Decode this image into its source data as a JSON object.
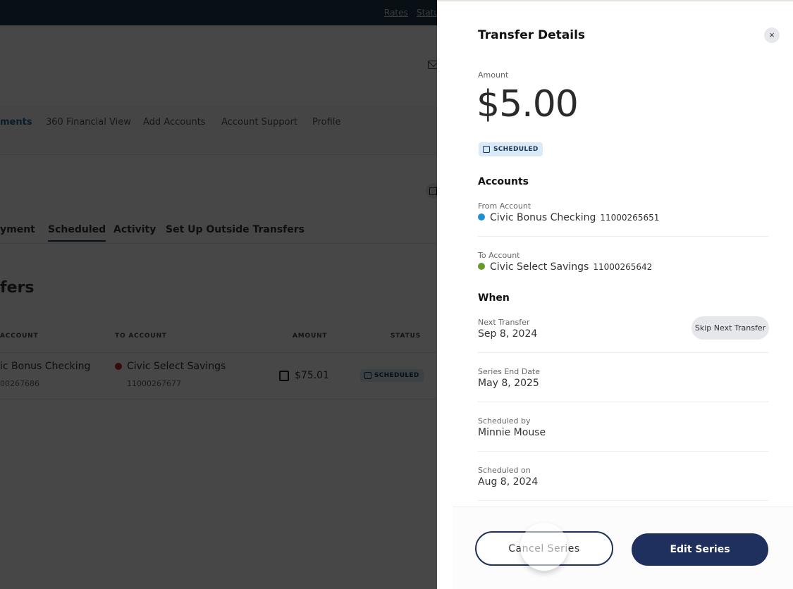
{
  "background": {
    "utility_links": [
      "Rates",
      "Status"
    ],
    "main_nav": [
      {
        "label": "ments",
        "active": true
      },
      {
        "label": "360 Financial View",
        "active": false
      },
      {
        "label": "Add Accounts",
        "active": false
      },
      {
        "label": "Account Support",
        "active": false
      },
      {
        "label": "Profile",
        "active": false
      }
    ],
    "sub_tabs": [
      {
        "label": "yment",
        "active": false
      },
      {
        "label": "Scheduled",
        "active": true
      },
      {
        "label": "Activity",
        "active": false
      },
      {
        "label": "Set Up Outside Transfers",
        "active": false
      }
    ],
    "section_title": "fers",
    "table": {
      "columns": [
        "ACCOUNT",
        "TO ACCOUNT",
        "AMOUNT",
        "STATUS"
      ],
      "rows": [
        {
          "from_name": "ic Bonus Checking",
          "from_number": "00267686",
          "to_name": "Civic Select Savings",
          "to_number": "11000267677",
          "to_color": "#c0292f",
          "amount": "$75.01",
          "status": "SCHEDULED"
        }
      ]
    }
  },
  "drawer": {
    "title": "Transfer Details",
    "close_icon": "×",
    "amount_label": "Amount",
    "amount": "$5.00",
    "status": "SCHEDULED",
    "accounts_heading": "Accounts",
    "from": {
      "label": "From Account",
      "name": "Civic Bonus Checking",
      "number": "11000265651",
      "color": "#1e8fd1"
    },
    "to": {
      "label": "To Account",
      "name": "Civic Select Savings",
      "number": "11000265642",
      "color": "#6a9a2c"
    },
    "when_heading": "When",
    "next_transfer": {
      "label": "Next Transfer",
      "value": "Sep 8, 2024"
    },
    "skip_button": "Skip Next Transfer",
    "series_end": {
      "label": "Series End Date",
      "value": "May 8, 2025"
    },
    "scheduled_by": {
      "label": "Scheduled by",
      "value": "Minnie Mouse"
    },
    "scheduled_on": {
      "label": "Scheduled on",
      "value": "Aug 8, 2024"
    },
    "cancel_button": "Cancel Series",
    "edit_button": "Edit Series"
  }
}
